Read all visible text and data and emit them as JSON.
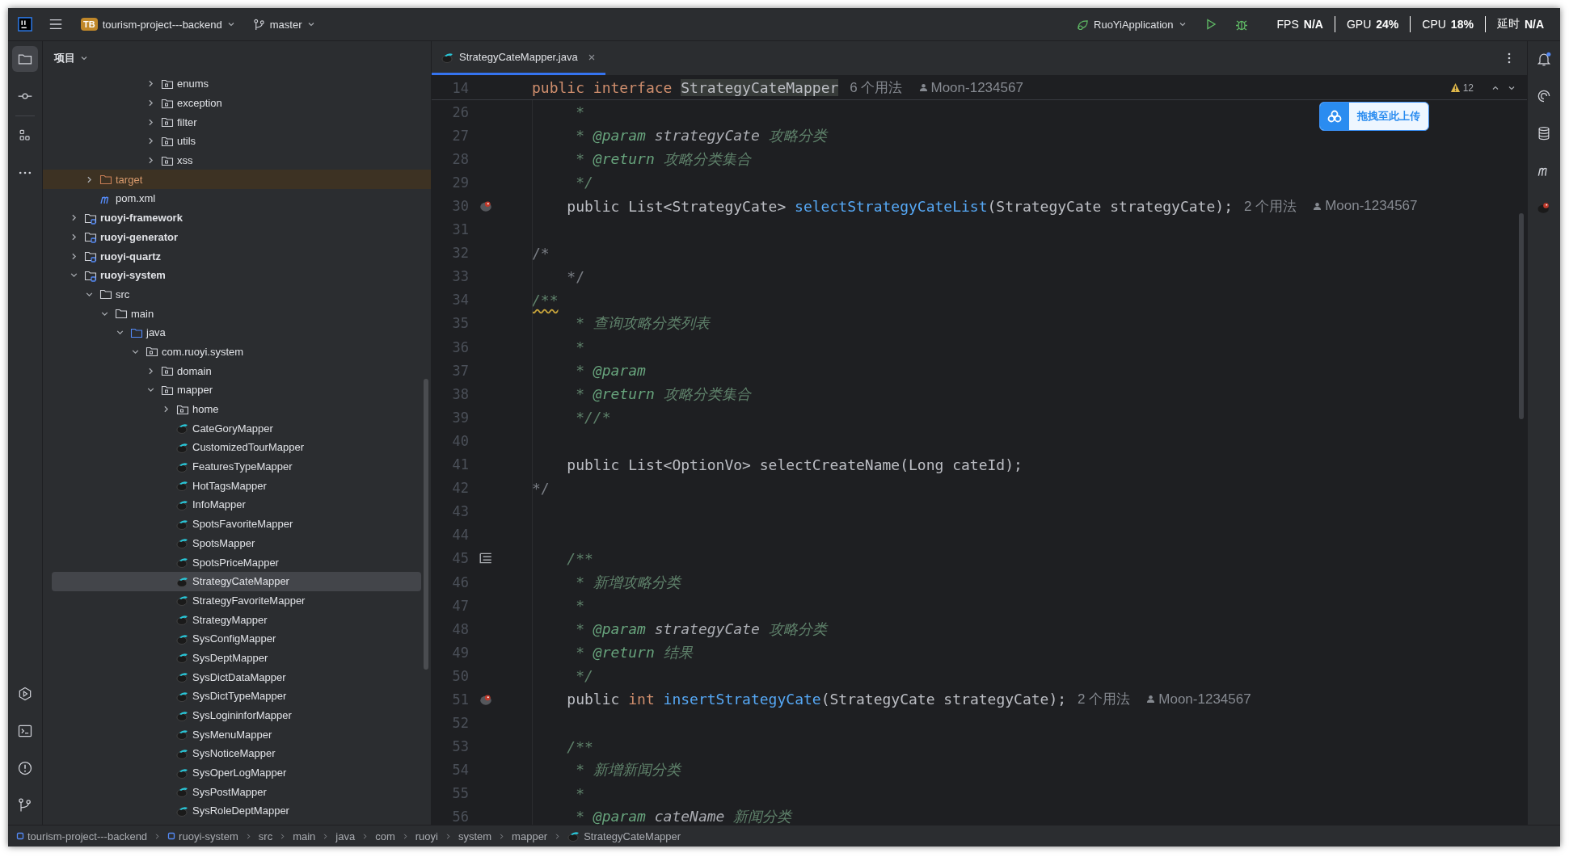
{
  "title_bar": {
    "project_badge": "TB",
    "project": "tourism-project---backend",
    "branch": "master",
    "run_config": "RuoYiApplication"
  },
  "overlay_stats": [
    {
      "label": "FPS",
      "value": "N/A"
    },
    {
      "label": "GPU",
      "value": "24%"
    },
    {
      "label": "CPU",
      "value": "18%"
    },
    {
      "label": "延时",
      "value": "N/A"
    }
  ],
  "left_toolbar": {
    "top": [
      {
        "kind": "folder",
        "selected": true
      },
      {
        "kind": "commit",
        "selected": false
      },
      {
        "kind": "structure",
        "selected": false
      },
      {
        "kind": "more",
        "selected": false
      }
    ],
    "bottom": [
      {
        "kind": "run",
        "selected": false
      },
      {
        "kind": "terminal",
        "selected": false
      },
      {
        "kind": "problems",
        "selected": false
      },
      {
        "kind": "git",
        "selected": false
      }
    ]
  },
  "project_panel": {
    "title": "项目",
    "tree": [
      {
        "children": [
          {
            "children": [
              {
                "children": [
                  {
                    "children": [
                      {
                        "children": [
                          {
                            "label": "enums",
                            "kind": "package",
                            "expanded": false,
                            "selected": false
                          },
                          {
                            "label": "exception",
                            "kind": "package",
                            "expanded": false,
                            "selected": false
                          },
                          {
                            "label": "filter",
                            "kind": "package",
                            "expanded": false,
                            "selected": false
                          },
                          {
                            "label": "utils",
                            "kind": "package",
                            "expanded": false,
                            "selected": false
                          },
                          {
                            "label": "xss",
                            "kind": "package",
                            "expanded": false,
                            "selected": false
                          }
                        ]
                      }
                    ]
                  }
                ]
              }
            ]
          },
          {
            "label": "target",
            "kind": "excluded",
            "expanded": false,
            "selected": false
          },
          {
            "label": "pom.xml",
            "kind": "maven",
            "selected": false
          }
        ]
      },
      {
        "label": "ruoyi-framework",
        "kind": "module",
        "expanded": false,
        "selected": false
      },
      {
        "label": "ruoyi-generator",
        "kind": "module",
        "expanded": false,
        "selected": false
      },
      {
        "label": "ruoyi-quartz",
        "kind": "module",
        "expanded": false,
        "selected": false
      },
      {
        "label": "ruoyi-system",
        "kind": "module",
        "expanded": true,
        "selected": false,
        "children": [
          {
            "label": "src",
            "kind": "folder",
            "expanded": true,
            "selected": false,
            "children": [
              {
                "label": "main",
                "kind": "folder",
                "expanded": true,
                "selected": false,
                "children": [
                  {
                    "label": "java",
                    "kind": "source",
                    "expanded": true,
                    "selected": false,
                    "children": [
                      {
                        "label": "com.ruoyi.system",
                        "kind": "package",
                        "expanded": true,
                        "selected": false,
                        "children": [
                          {
                            "label": "domain",
                            "kind": "package",
                            "expanded": false,
                            "selected": false
                          },
                          {
                            "label": "mapper",
                            "kind": "package",
                            "expanded": true,
                            "selected": false,
                            "children": [
                              {
                                "label": "home",
                                "kind": "package",
                                "expanded": false,
                                "selected": false
                              },
                              {
                                "label": "CateGoryMapper",
                                "kind": "mapper",
                                "selected": false
                              },
                              {
                                "label": "CustomizedTourMapper",
                                "kind": "mapper",
                                "selected": false
                              },
                              {
                                "label": "FeaturesTypeMapper",
                                "kind": "mapper",
                                "selected": false
                              },
                              {
                                "label": "HotTagsMapper",
                                "kind": "mapper",
                                "selected": false
                              },
                              {
                                "label": "InfoMapper",
                                "kind": "mapper",
                                "selected": false
                              },
                              {
                                "label": "SpotsFavoriteMapper",
                                "kind": "mapper",
                                "selected": false
                              },
                              {
                                "label": "SpotsMapper",
                                "kind": "mapper",
                                "selected": false
                              },
                              {
                                "label": "SpotsPriceMapper",
                                "kind": "mapper",
                                "selected": false
                              },
                              {
                                "label": "StrategyCateMapper",
                                "kind": "mapper",
                                "selected": true
                              },
                              {
                                "label": "StrategyFavoriteMapper",
                                "kind": "mapper",
                                "selected": false
                              },
                              {
                                "label": "StrategyMapper",
                                "kind": "mapper",
                                "selected": false
                              },
                              {
                                "label": "SysConfigMapper",
                                "kind": "mapper",
                                "selected": false
                              },
                              {
                                "label": "SysDeptMapper",
                                "kind": "mapper",
                                "selected": false
                              },
                              {
                                "label": "SysDictDataMapper",
                                "kind": "mapper",
                                "selected": false
                              },
                              {
                                "label": "SysDictTypeMapper",
                                "kind": "mapper",
                                "selected": false
                              },
                              {
                                "label": "SysLogininforMapper",
                                "kind": "mapper",
                                "selected": false
                              },
                              {
                                "label": "SysMenuMapper",
                                "kind": "mapper",
                                "selected": false
                              },
                              {
                                "label": "SysNoticeMapper",
                                "kind": "mapper",
                                "selected": false
                              },
                              {
                                "label": "SysOperLogMapper",
                                "kind": "mapper",
                                "selected": false
                              },
                              {
                                "label": "SysPostMapper",
                                "kind": "mapper",
                                "selected": false
                              },
                              {
                                "label": "SysRoleDeptMapper",
                                "kind": "mapper",
                                "selected": false
                              }
                            ]
                          }
                        ]
                      }
                    ]
                  }
                ]
              }
            ]
          }
        ]
      }
    ]
  },
  "editor": {
    "tabs": [
      {
        "label": "StrategyCateMapper.java",
        "selected": true
      }
    ],
    "warnings": "12",
    "sticky_line": {
      "number": "14",
      "tokens": [
        {
          "t": "public interface ",
          "kind": "keyword"
        },
        {
          "t": "StrategyCateMapper",
          "kind": "highlight"
        }
      ],
      "hint": "6 个用法",
      "author": "Moon-1234567"
    },
    "lines": [
      {
        "number": "26",
        "tokens": [
          {
            "t": "     *",
            "kind": "doc"
          }
        ]
      },
      {
        "number": "27",
        "tokens": [
          {
            "t": "     * ",
            "kind": "doc"
          },
          {
            "t": "@param",
            "kind": "tag"
          },
          {
            "t": " strategyCate",
            "kind": "param"
          },
          {
            "t": " 攻略分类",
            "kind": "doc"
          }
        ]
      },
      {
        "number": "28",
        "tokens": [
          {
            "t": "     * ",
            "kind": "doc"
          },
          {
            "t": "@return",
            "kind": "tag"
          },
          {
            "t": " 攻略分类集合",
            "kind": "doc"
          }
        ]
      },
      {
        "number": "29",
        "tokens": [
          {
            "t": "     */",
            "kind": "doc"
          }
        ]
      },
      {
        "number": "30",
        "marker": {
          "kind": "mapper"
        },
        "tokens": [
          {
            "t": "    public List<StrategyCate> ",
            "kind": "plain"
          },
          {
            "t": "selectStrategyCateList",
            "kind": "method"
          },
          {
            "t": "(StrategyCate strategyCate);",
            "kind": "plain"
          }
        ],
        "hint": "2 个用法",
        "author": "Moon-1234567"
      },
      {
        "number": "31"
      },
      {
        "number": "32",
        "tokens": [
          {
            "t": "/*",
            "kind": "comment"
          }
        ]
      },
      {
        "number": "33",
        "tokens": [
          {
            "t": "    */",
            "kind": "comment"
          }
        ]
      },
      {
        "number": "34",
        "tokens": [
          {
            "t": "/**",
            "kind": "warn"
          }
        ]
      },
      {
        "number": "35",
        "tokens": [
          {
            "t": "     * 查询攻略分类列表",
            "kind": "doc"
          }
        ]
      },
      {
        "number": "36",
        "tokens": [
          {
            "t": "     *",
            "kind": "doc"
          }
        ]
      },
      {
        "number": "37",
        "tokens": [
          {
            "t": "     * ",
            "kind": "doc"
          },
          {
            "t": "@param",
            "kind": "tag"
          }
        ]
      },
      {
        "number": "38",
        "tokens": [
          {
            "t": "     * ",
            "kind": "doc"
          },
          {
            "t": "@return",
            "kind": "tag"
          },
          {
            "t": " 攻略分类集合",
            "kind": "doc"
          }
        ]
      },
      {
        "number": "39",
        "tokens": [
          {
            "t": "     *//*",
            "kind": "doc"
          }
        ]
      },
      {
        "number": "40"
      },
      {
        "number": "41",
        "tokens": [
          {
            "t": "    public List<OptionVo> selectCreateName(Long cateId);",
            "kind": "plain"
          }
        ]
      },
      {
        "number": "42",
        "tokens": [
          {
            "t": "*/",
            "kind": "comment"
          }
        ]
      },
      {
        "number": "43"
      },
      {
        "number": "44"
      },
      {
        "number": "45",
        "marker": {
          "kind": "doc"
        },
        "tokens": [
          {
            "t": "    /**",
            "kind": "doc"
          }
        ]
      },
      {
        "number": "46",
        "tokens": [
          {
            "t": "     * 新增攻略分类",
            "kind": "doc"
          }
        ]
      },
      {
        "number": "47",
        "tokens": [
          {
            "t": "     *",
            "kind": "doc"
          }
        ]
      },
      {
        "number": "48",
        "tokens": [
          {
            "t": "     * ",
            "kind": "doc"
          },
          {
            "t": "@param",
            "kind": "tag"
          },
          {
            "t": " strategyCate",
            "kind": "param"
          },
          {
            "t": " 攻略分类",
            "kind": "doc"
          }
        ]
      },
      {
        "number": "49",
        "tokens": [
          {
            "t": "     * ",
            "kind": "doc"
          },
          {
            "t": "@return",
            "kind": "tag"
          },
          {
            "t": " 结果",
            "kind": "doc"
          }
        ]
      },
      {
        "number": "50",
        "tokens": [
          {
            "t": "     */",
            "kind": "doc"
          }
        ]
      },
      {
        "number": "51",
        "marker": {
          "kind": "mapper"
        },
        "tokens": [
          {
            "t": "    public ",
            "kind": "plain"
          },
          {
            "t": "int ",
            "kind": "keyword"
          },
          {
            "t": "insertStrategyCate",
            "kind": "method"
          },
          {
            "t": "(StrategyCate strategyCate);",
            "kind": "plain"
          }
        ],
        "hint": "2 个用法",
        "author": "Moon-1234567"
      },
      {
        "number": "52"
      },
      {
        "number": "53",
        "tokens": [
          {
            "t": "    /**",
            "kind": "doc"
          }
        ]
      },
      {
        "number": "54",
        "tokens": [
          {
            "t": "     * 新增新闻分类",
            "kind": "doc"
          }
        ]
      },
      {
        "number": "55",
        "tokens": [
          {
            "t": "     *",
            "kind": "doc"
          }
        ]
      },
      {
        "number": "56",
        "tokens": [
          {
            "t": "     * ",
            "kind": "doc"
          },
          {
            "t": "@param",
            "kind": "tag"
          },
          {
            "t": " cateName",
            "kind": "param"
          },
          {
            "t": " 新闻分类",
            "kind": "doc"
          }
        ]
      }
    ]
  },
  "upload_widget": {
    "label": "拖拽至此上传"
  },
  "right_toolbar": [
    {
      "kind": "notifications",
      "badge": true
    },
    {
      "kind": "assistant",
      "badge": false
    },
    {
      "kind": "database",
      "badge": false
    },
    {
      "kind": "maven",
      "badge": false
    },
    {
      "kind": "mybatis",
      "badge": false
    }
  ],
  "breadcrumbs": [
    {
      "label": "tourism-project---backend",
      "kind": "module"
    },
    {
      "label": "ruoyi-system",
      "kind": "module"
    },
    {
      "label": "src",
      "kind": "plain"
    },
    {
      "label": "main",
      "kind": "plain"
    },
    {
      "label": "java",
      "kind": "plain"
    },
    {
      "label": "com",
      "kind": "plain"
    },
    {
      "label": "ruoyi",
      "kind": "plain"
    },
    {
      "label": "system",
      "kind": "plain"
    },
    {
      "label": "mapper",
      "kind": "plain"
    },
    {
      "label": "StrategyCateMapper",
      "kind": "mapper"
    }
  ]
}
